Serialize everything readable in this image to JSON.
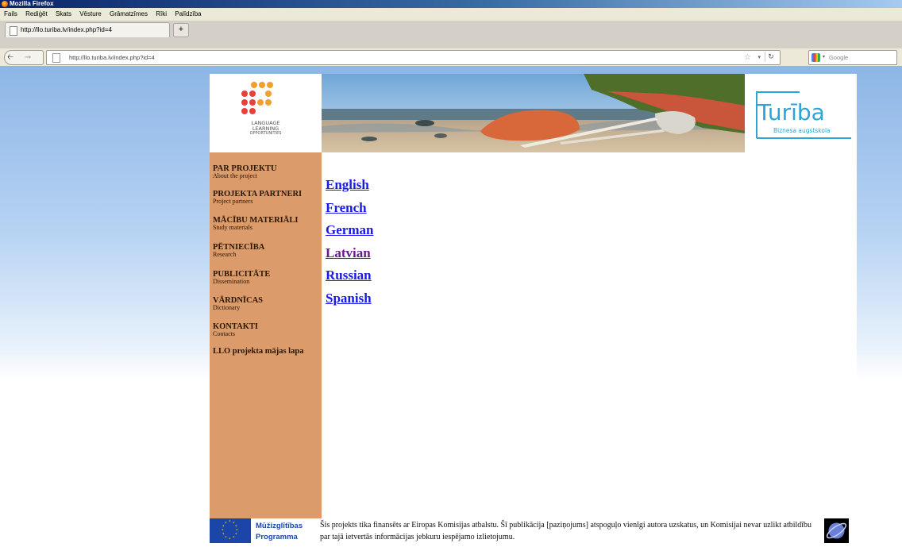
{
  "window": {
    "title": "Mozilla Firefox"
  },
  "menubar": {
    "items": [
      "Fails",
      "Rediģēt",
      "Skats",
      "Vēsture",
      "Grāmatzīmes",
      "Rīki",
      "Palīdzība"
    ]
  },
  "tabs": [
    {
      "label": "http://llo.turiba.lv/index.php?id=4"
    }
  ],
  "newtab": {
    "label": "+"
  },
  "navbar": {
    "url": "http://llo.turiba.lv/index.php?id=4",
    "search_placeholder": "Google",
    "back_icon": "back-arrow-icon",
    "forward_icon": "forward-arrow-icon"
  },
  "header": {
    "logo_text": [
      "LANGUAGE",
      "LEARNING",
      "OPPORTUNITIES"
    ],
    "turiba_name": "Turība",
    "turiba_sub": "Biznesa augstskola"
  },
  "sidebar": {
    "items": [
      {
        "title": "PAR PROJEKTU",
        "sub": "About the project"
      },
      {
        "title": "PROJEKTA PARTNERI",
        "sub": "Project partners"
      },
      {
        "title": "MĀCĪBU MATERIĀLI",
        "sub": "Study materials"
      },
      {
        "title": "PĒTNIECĪBA",
        "sub": "Research"
      },
      {
        "title": "PUBLICITĀTE",
        "sub": "Dissemination"
      },
      {
        "title": "VĀRDNĪCAS",
        "sub": "Dictionary"
      },
      {
        "title": "KONTAKTI",
        "sub": "Contacts"
      }
    ],
    "home_link": "LLO projekta mājas lapa"
  },
  "languages": [
    {
      "label": "English",
      "visited": false
    },
    {
      "label": "French",
      "visited": false
    },
    {
      "label": "German",
      "visited": false
    },
    {
      "label": "Latvian",
      "visited": true
    },
    {
      "label": "Russian",
      "visited": false
    },
    {
      "label": "Spanish",
      "visited": false
    }
  ],
  "footer": {
    "program_line1": "Mūžizglītības",
    "program_line2": "Programma",
    "text": "Šis projekts tika finansēts ar Eiropas Komisijas atbalstu. Šī publikācija [paziņojums] atspoguļo vienīgi autora uzskatus, un Komisijai nevar uzlikt atbildību par tajā ietvertās informācijas jebkuru iespējamo izlietojumu."
  },
  "colors": {
    "sidebar": "#dc9b6a",
    "link": "#1a1ae6",
    "visited_link": "#6a1a8c",
    "turiba_blue": "#29a6d6"
  }
}
